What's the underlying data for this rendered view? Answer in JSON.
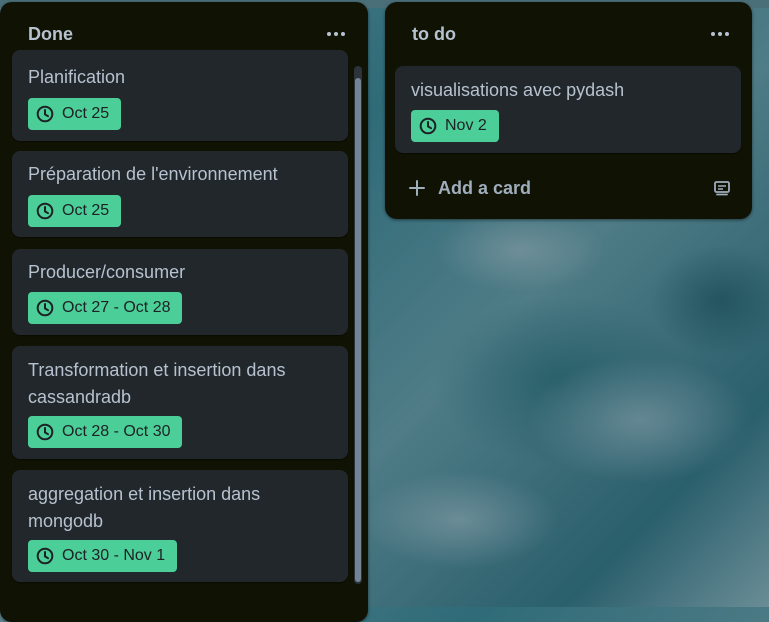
{
  "lists": [
    {
      "title": "Done",
      "cards": [
        {
          "title": "Planification",
          "date": "Oct 25"
        },
        {
          "title": "Préparation de l'environnement",
          "date": "Oct 25"
        },
        {
          "title": "Producer/consumer",
          "date": "Oct 27 - Oct 28"
        },
        {
          "title_line1": "Transformation et insertion dans",
          "title_line2": "cassandradb",
          "date": "Oct 28 - Oct 30"
        },
        {
          "title_line1": "aggregation et insertion dans",
          "title_line2": "mongodb",
          "date": "Oct 30 - Nov 1"
        }
      ]
    },
    {
      "title": "to do",
      "cards": [
        {
          "title": "visualisations avec pydash",
          "date": "Nov 2"
        }
      ],
      "add_card_label": "Add a card"
    }
  ],
  "colors": {
    "list_bg": "#101204",
    "card_bg": "#22272b",
    "date_badge_bg": "#4bce97",
    "text": "#b6c2cf"
  },
  "icons": [
    "clock-icon",
    "more-icon",
    "plus-icon",
    "card-template-icon"
  ]
}
